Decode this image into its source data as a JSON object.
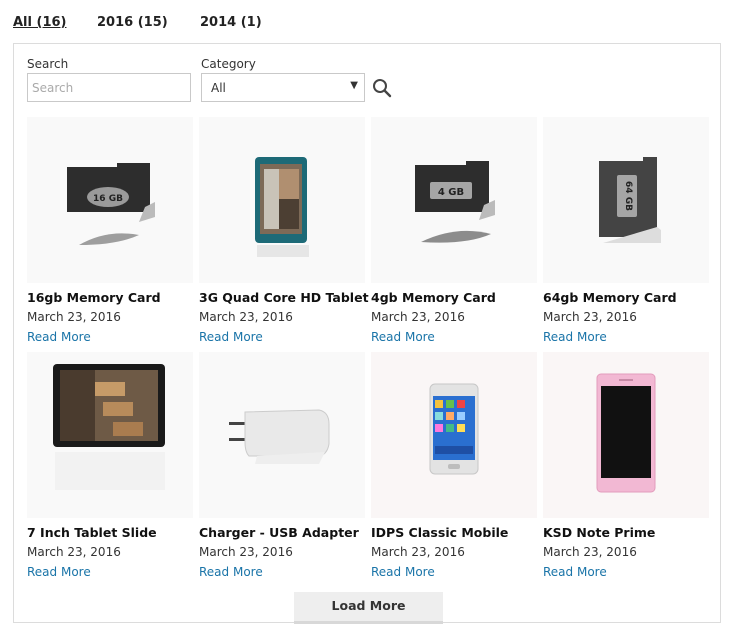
{
  "tabs": [
    {
      "label": "All (16)",
      "active": true
    },
    {
      "label": "2016 (15)",
      "active": false
    },
    {
      "label": "2014 (1)",
      "active": false
    }
  ],
  "filters": {
    "search_label": "Search",
    "search_placeholder": "Search",
    "search_value": "",
    "category_label": "Category",
    "category_value": "All",
    "search_button_icon": "magnifier-icon"
  },
  "products": [
    {
      "title": "16gb Memory Card",
      "date": "March 23, 2016",
      "link": "Read More",
      "image": "memory-card",
      "card_text": "16 GB"
    },
    {
      "title": "3G Quad Core HD Tablet",
      "date": "March 23, 2016",
      "link": "Read More",
      "image": "tablet-portrait"
    },
    {
      "title": "4gb Memory Card",
      "date": "March 23, 2016",
      "link": "Read More",
      "image": "memory-card",
      "card_text": "4 GB"
    },
    {
      "title": "64gb Memory Card",
      "date": "March 23, 2016",
      "link": "Read More",
      "image": "memory-card",
      "card_text": "64 GB"
    },
    {
      "title": "7 Inch Tablet Slide",
      "date": "March 23, 2016",
      "link": "Read More",
      "image": "tablet-landscape"
    },
    {
      "title": "Charger - USB Adapter",
      "date": "March 23, 2016",
      "link": "Read More",
      "image": "charger"
    },
    {
      "title": "IDPS Classic Mobile",
      "date": "March 23, 2016",
      "link": "Read More",
      "image": "phone-white"
    },
    {
      "title": "KSD Note Prime",
      "date": "March 23, 2016",
      "link": "Read More",
      "image": "phone-pink"
    }
  ],
  "load_more_label": "Load More"
}
